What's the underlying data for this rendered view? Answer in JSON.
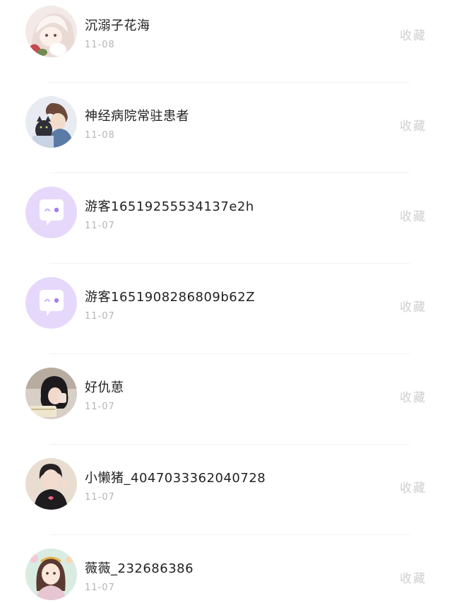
{
  "comments": [
    {
      "name": "沉溺子花海",
      "date": "11-08",
      "action": "收藏",
      "avatar": "anime-girl-avatar"
    },
    {
      "name": "神经病院常驻患者",
      "date": "11-08",
      "action": "收藏",
      "avatar": "boy-with-cat-avatar"
    },
    {
      "name": "游客16519255534137e2h",
      "date": "11-07",
      "action": "收藏",
      "avatar": "default-chat-bubble-avatar"
    },
    {
      "name": "游客1651908286809b62Z",
      "date": "11-07",
      "action": "收藏",
      "avatar": "default-chat-bubble-avatar"
    },
    {
      "name": "好仇葸",
      "date": "11-07",
      "action": "收藏",
      "avatar": "girl-photo-avatar"
    },
    {
      "name": "小懒猪_4047033362040728",
      "date": "11-07",
      "action": "收藏",
      "avatar": "person-photo-avatar"
    },
    {
      "name": "薇薇_232686386",
      "date": "11-07",
      "action": "收藏",
      "avatar": "illustrated-girl-avatar"
    }
  ],
  "colors": {
    "default_avatar_bg": "#e6d8fb",
    "default_avatar_accent": "#a77ef0",
    "name_text": "#222222",
    "date_text": "#b5b5b5",
    "action_text": "#cfcfcf"
  }
}
